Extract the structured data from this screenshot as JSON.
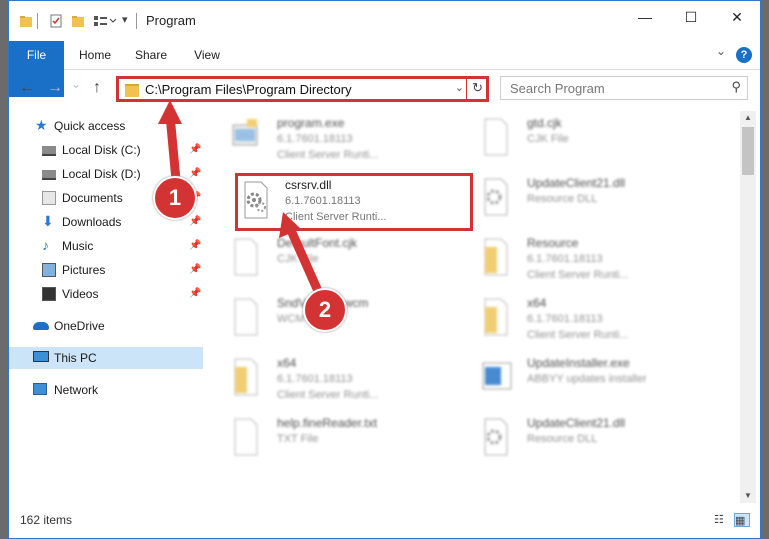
{
  "window": {
    "title": "Program",
    "controls": {
      "minimize": "—",
      "maximize": "☐",
      "close": "✕"
    }
  },
  "ribbon": {
    "tabs": [
      "File",
      "Home",
      "Share",
      "View"
    ],
    "expand": "⌄",
    "help": "?"
  },
  "nav": {
    "back": "←",
    "forward": "→",
    "recent": "⌄",
    "up": "↑",
    "address": "C:\\Program Files\\Program Directory",
    "address_dropdown": "⌄",
    "refresh": "↻",
    "search_placeholder": "Search Program",
    "search_icon": "⚲"
  },
  "sidebar": {
    "items": [
      {
        "label": "Quick access",
        "icon": "star-icon",
        "pinned": false
      },
      {
        "label": "Local Disk (C:)",
        "icon": "drive-icon",
        "pinned": true
      },
      {
        "label": "Local Disk (D:)",
        "icon": "drive-icon",
        "pinned": true
      },
      {
        "label": "Documents",
        "icon": "documents-icon",
        "pinned": true
      },
      {
        "label": "Downloads",
        "icon": "downloads-icon",
        "pinned": true
      },
      {
        "label": "Music",
        "icon": "music-icon",
        "pinned": true
      },
      {
        "label": "Pictures",
        "icon": "pictures-icon",
        "pinned": true
      },
      {
        "label": "Videos",
        "icon": "videos-icon",
        "pinned": true
      },
      {
        "label": "OneDrive",
        "icon": "cloud-icon",
        "pinned": false
      },
      {
        "label": "This PC",
        "icon": "computer-icon",
        "pinned": false,
        "selected": true
      },
      {
        "label": "Network",
        "icon": "network-icon",
        "pinned": false
      }
    ],
    "pin_glyph": "📌"
  },
  "files": [
    {
      "name": "program.exe",
      "line1": "6.1.7601.18113",
      "line2": "Client Server Runti...",
      "icon": "exe-icon",
      "blurred": true
    },
    {
      "name": "gtd.cjk",
      "line1": "CJK File",
      "line2": "",
      "icon": "blank-file-icon",
      "blurred": true
    },
    {
      "name": "csrsrv.dll",
      "line1": "6.1.7601.18113",
      "line2": "Client Server Runti...",
      "icon": "dll-gear-icon",
      "blurred": false,
      "highlight": true
    },
    {
      "name": "UpdateClient21.dll",
      "line1": "Resource DLL",
      "line2": "",
      "icon": "dll-gear-icon",
      "blurred": true
    },
    {
      "name": "DefaultFont.cjk",
      "line1": "CJK File",
      "line2": "",
      "icon": "blank-file-icon",
      "blurred": true
    },
    {
      "name": "Resource",
      "line1": "6.1.7601.18113",
      "line2": "Client Server Runti...",
      "icon": "folder-file-icon",
      "blurred": true
    },
    {
      "name": "SndVolSSO.wcm",
      "line1": "WCM File",
      "line2": "",
      "icon": "blank-file-icon",
      "blurred": true
    },
    {
      "name": "x64",
      "line1": "6.1.7601.18113",
      "line2": "Client Server Runti...",
      "icon": "folder-file-icon",
      "blurred": true
    },
    {
      "name": "x64",
      "line1": "6.1.7601.18113",
      "line2": "Client Server Runti...",
      "icon": "folder-file-icon",
      "blurred": true
    },
    {
      "name": "UpdateInstaller.exe",
      "line1": "ABBYY updates installer",
      "line2": "",
      "icon": "installer-icon",
      "blurred": true
    },
    {
      "name": "help.fineReader.txt",
      "line1": "TXT File",
      "line2": "",
      "icon": "blank-file-icon",
      "blurred": true
    },
    {
      "name": "UpdateClient21.dll",
      "line1": "Resource DLL",
      "line2": "",
      "icon": "dll-gear-icon",
      "blurred": true
    }
  ],
  "status": {
    "items_count": "162 items",
    "details_view": "☷",
    "tiles_view": "▦"
  },
  "annotations": {
    "step1": "1",
    "step2": "2",
    "color": "#d43333"
  },
  "colors": {
    "accent": "#1a6fc6",
    "selected_bg": "#cce4f7",
    "highlight": "#d43333"
  }
}
